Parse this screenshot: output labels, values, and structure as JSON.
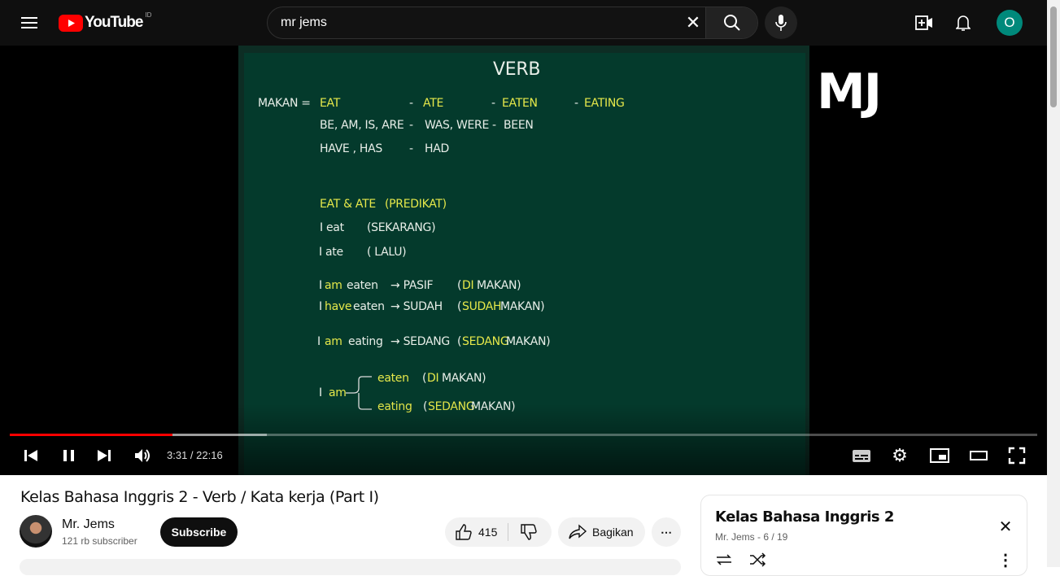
{
  "header": {
    "logo_text": "YouTube",
    "region": "ID",
    "search_value": "mr jems",
    "avatar_letter": "O"
  },
  "video": {
    "watermark": "MJ",
    "board": {
      "title": "VERB",
      "r1": [
        "MAKAN  =",
        "EAT",
        "-",
        "ATE",
        "-",
        "EATEN",
        "-",
        "EATING"
      ],
      "r2": [
        "BE, AM, IS, ARE",
        "-",
        "WAS, WERE",
        "-",
        "BEEN"
      ],
      "r3": [
        "HAVE , HAS",
        "-",
        "HAD"
      ],
      "r4": [
        "EAT & ATE",
        "(PREDIKAT)"
      ],
      "r5": [
        "I eat",
        "(SEKARANG)"
      ],
      "r6": [
        "I ate",
        "( LALU)"
      ],
      "r7": [
        "I",
        "am",
        "eaten",
        "→ PASIF",
        "(",
        "DI",
        "MAKAN)"
      ],
      "r8": [
        "I",
        "have",
        "eaten",
        "→ SUDAH",
        "(",
        "SUDAH",
        "MAKAN)"
      ],
      "r9": [
        "I",
        "am",
        "eating",
        "→ SEDANG",
        "(",
        "SEDANG",
        "MAKAN)"
      ],
      "r10": [
        "I",
        "am",
        "eaten",
        "(",
        "DI",
        "MAKAN)",
        "eating",
        "(",
        "SEDANG",
        "MAKAN)"
      ]
    },
    "progress": {
      "played_fraction": 0.158,
      "buffered_fraction": 0.25
    },
    "time": "3:31 / 22:16",
    "colors": {
      "played": "#ff0000",
      "board": "#043a2c",
      "highlight": "#e6e84a"
    }
  },
  "info": {
    "title": "Kelas Bahasa Inggris 2 - Verb / Kata kerja (Part I)",
    "channel": "Mr. Jems",
    "subscribers": "121 rb subscriber",
    "subscribe_label": "Subscribe",
    "likes": "415",
    "share_label": "Bagikan"
  },
  "playlist": {
    "title": "Kelas Bahasa Inggris 2",
    "subtitle": "Mr. Jems - 6 / 19"
  }
}
